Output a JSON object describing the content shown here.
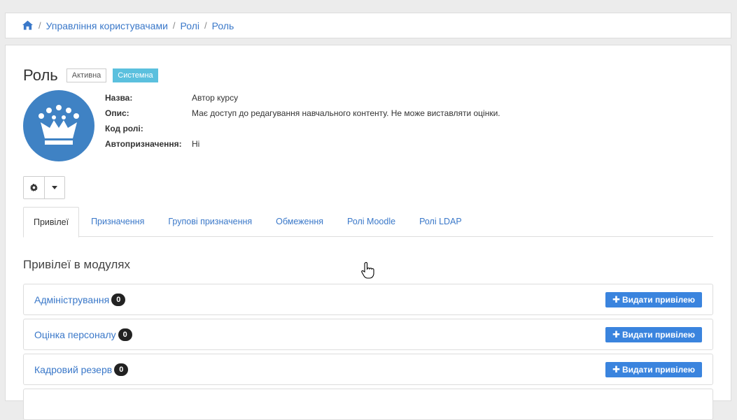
{
  "breadcrumb": {
    "items": [
      "Управління користувачами",
      "Ролі",
      "Роль"
    ],
    "separator": "/"
  },
  "header": {
    "title": "Роль",
    "badge_active": "Активна",
    "badge_system": "Системна"
  },
  "info": {
    "name_label": "Назва:",
    "name_value": "Автор курсу",
    "desc_label": "Опис:",
    "desc_value": "Має доступ до редагування навчального контенту. Не може виставляти оцінки.",
    "code_label": "Код ролі:",
    "code_value": "",
    "auto_label": "Автопризначення:",
    "auto_value": "Ні"
  },
  "tabs": [
    "Привілеї",
    "Призначення",
    "Групові призначення",
    "Обмеження",
    "Ролі Moodle",
    "Ролі LDAP"
  ],
  "section": {
    "title": "Привілеї в модулях"
  },
  "modules": [
    {
      "name": "Адміністрування",
      "count": "0",
      "button": "Видати привілею"
    },
    {
      "name": "Оцінка персоналу",
      "count": "0",
      "button": "Видати привілею"
    },
    {
      "name": "Кадровий резерв",
      "count": "0",
      "button": "Видати привілею"
    }
  ],
  "colors": {
    "link": "#3a78c9",
    "avatar": "#3f82c4",
    "badge_system": "#5bc0de",
    "primary_button": "#3a84de"
  },
  "icons": [
    "home-icon",
    "crown-icon",
    "gear-icon",
    "caret-down-icon",
    "plus-icon",
    "hand-cursor-icon"
  ]
}
